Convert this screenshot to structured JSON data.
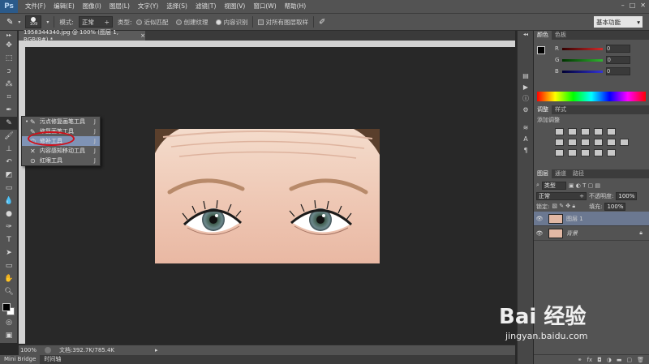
{
  "app": {
    "logo": "Ps"
  },
  "menubar": {
    "items": [
      "文件(F)",
      "编辑(E)",
      "图像(I)",
      "图层(L)",
      "文字(Y)",
      "选择(S)",
      "滤镜(T)",
      "视图(V)",
      "窗口(W)",
      "帮助(H)"
    ],
    "controls": {
      "minimize": "–",
      "restore": "□",
      "close": "✕"
    }
  },
  "options": {
    "brush_size": "109",
    "mode_label": "模式:",
    "mode_value": "正常",
    "type_label": "类型:",
    "type_options": [
      "近似匹配",
      "创建纹理",
      "内容识别"
    ],
    "selected_type_index": 2,
    "sample_all_label": "对所有图层取样",
    "workspace": "基本功能"
  },
  "document": {
    "tab_title": "1958344340.jpg @ 100% (图层 1, RGB/8#) *",
    "tab_close": "×",
    "zoom": "100%",
    "doc_info": "文档:392.7K/785.4K"
  },
  "flyout": {
    "items": [
      {
        "label": "污点修复画笔工具",
        "key": "J",
        "icon": "spot-healing-brush-icon"
      },
      {
        "label": "修复画笔工具",
        "key": "J",
        "icon": "healing-brush-icon"
      },
      {
        "label": "修补工具",
        "key": "J",
        "icon": "patch-icon"
      },
      {
        "label": "内容感知移动工具",
        "key": "J",
        "icon": "content-aware-move-icon"
      },
      {
        "label": "红眼工具",
        "key": "J",
        "icon": "red-eye-icon"
      }
    ],
    "selected_index": 2,
    "active_index": 0,
    "highlight_color": "#d0101a"
  },
  "bottom_tabs": [
    "Mini Bridge",
    "时间轴"
  ],
  "color_panel": {
    "tabs": [
      "颜色",
      "色板"
    ],
    "channels": [
      {
        "name": "R",
        "value": "0",
        "color": "#d12b2b"
      },
      {
        "name": "G",
        "value": "0",
        "color": "#2fb52f"
      },
      {
        "name": "B",
        "value": "0",
        "color": "#3333d6"
      }
    ]
  },
  "adjust_panel": {
    "tabs": [
      "调整",
      "样式"
    ],
    "title": "添加调整"
  },
  "layers_panel": {
    "tabs": [
      "图层",
      "通道",
      "路径"
    ],
    "kind_label": "类型",
    "blend_mode": "正常",
    "opacity_label": "不透明度:",
    "opacity_value": "100%",
    "lock_label": "锁定:",
    "fill_label": "填充:",
    "fill_value": "100%",
    "layers": [
      {
        "name": "图层 1",
        "selected": true,
        "locked": false
      },
      {
        "name": "背景",
        "selected": false,
        "locked": true
      }
    ]
  },
  "watermark": {
    "brand": "Bai 经验",
    "sub": "jingyan.baidu.com"
  },
  "colors": {
    "accent_selection": "#6b7891",
    "flyout_selected": "#7f93b5"
  }
}
